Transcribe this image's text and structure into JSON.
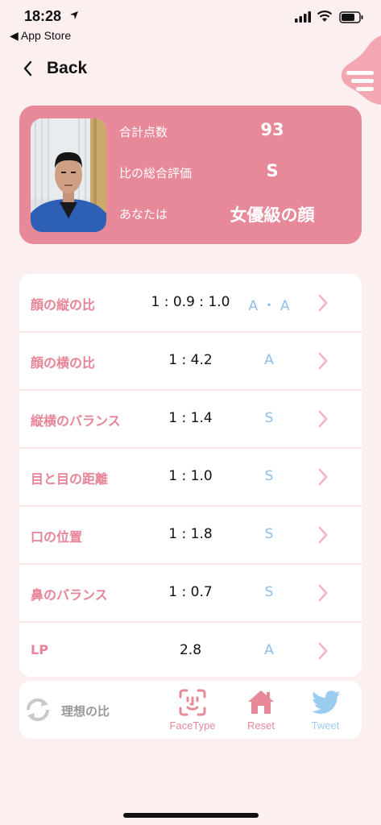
{
  "status_bar": {
    "time": "18:28",
    "back_app": "◀ App Store"
  },
  "nav": {
    "back_label": "Back"
  },
  "summary": {
    "rows": [
      {
        "key": "合計点数",
        "value": "93"
      },
      {
        "key": "比の総合評価",
        "value": "S"
      },
      {
        "key": "あなたは",
        "value": "女優級の顔"
      }
    ]
  },
  "metrics": [
    {
      "label": "顔の縦の比",
      "ratio": "1 : 0.9 : 1.0",
      "grade": "A ・ A"
    },
    {
      "label": "顔の横の比",
      "ratio": "1 : 4.2",
      "grade": "A"
    },
    {
      "label": "縦横のバランス",
      "ratio": "1 : 1.4",
      "grade": "S"
    },
    {
      "label": "目と目の距離",
      "ratio": "1 : 1.0",
      "grade": "S"
    },
    {
      "label": "口の位置",
      "ratio": "1 : 1.8",
      "grade": "S"
    },
    {
      "label": "鼻のバランス",
      "ratio": "1 : 0.7",
      "grade": "S"
    },
    {
      "label": "LP",
      "ratio": "2.8",
      "grade": "A"
    }
  ],
  "toolbar": {
    "ideal_label": "理想の比",
    "facetype_label": "FaceType",
    "reset_label": "Reset",
    "tweet_label": "Tweet"
  },
  "colors": {
    "accent_pink": "#e8899a",
    "label_pink": "#e78497",
    "grade_blue": "#8fbfe8",
    "background": "#fbefef"
  }
}
